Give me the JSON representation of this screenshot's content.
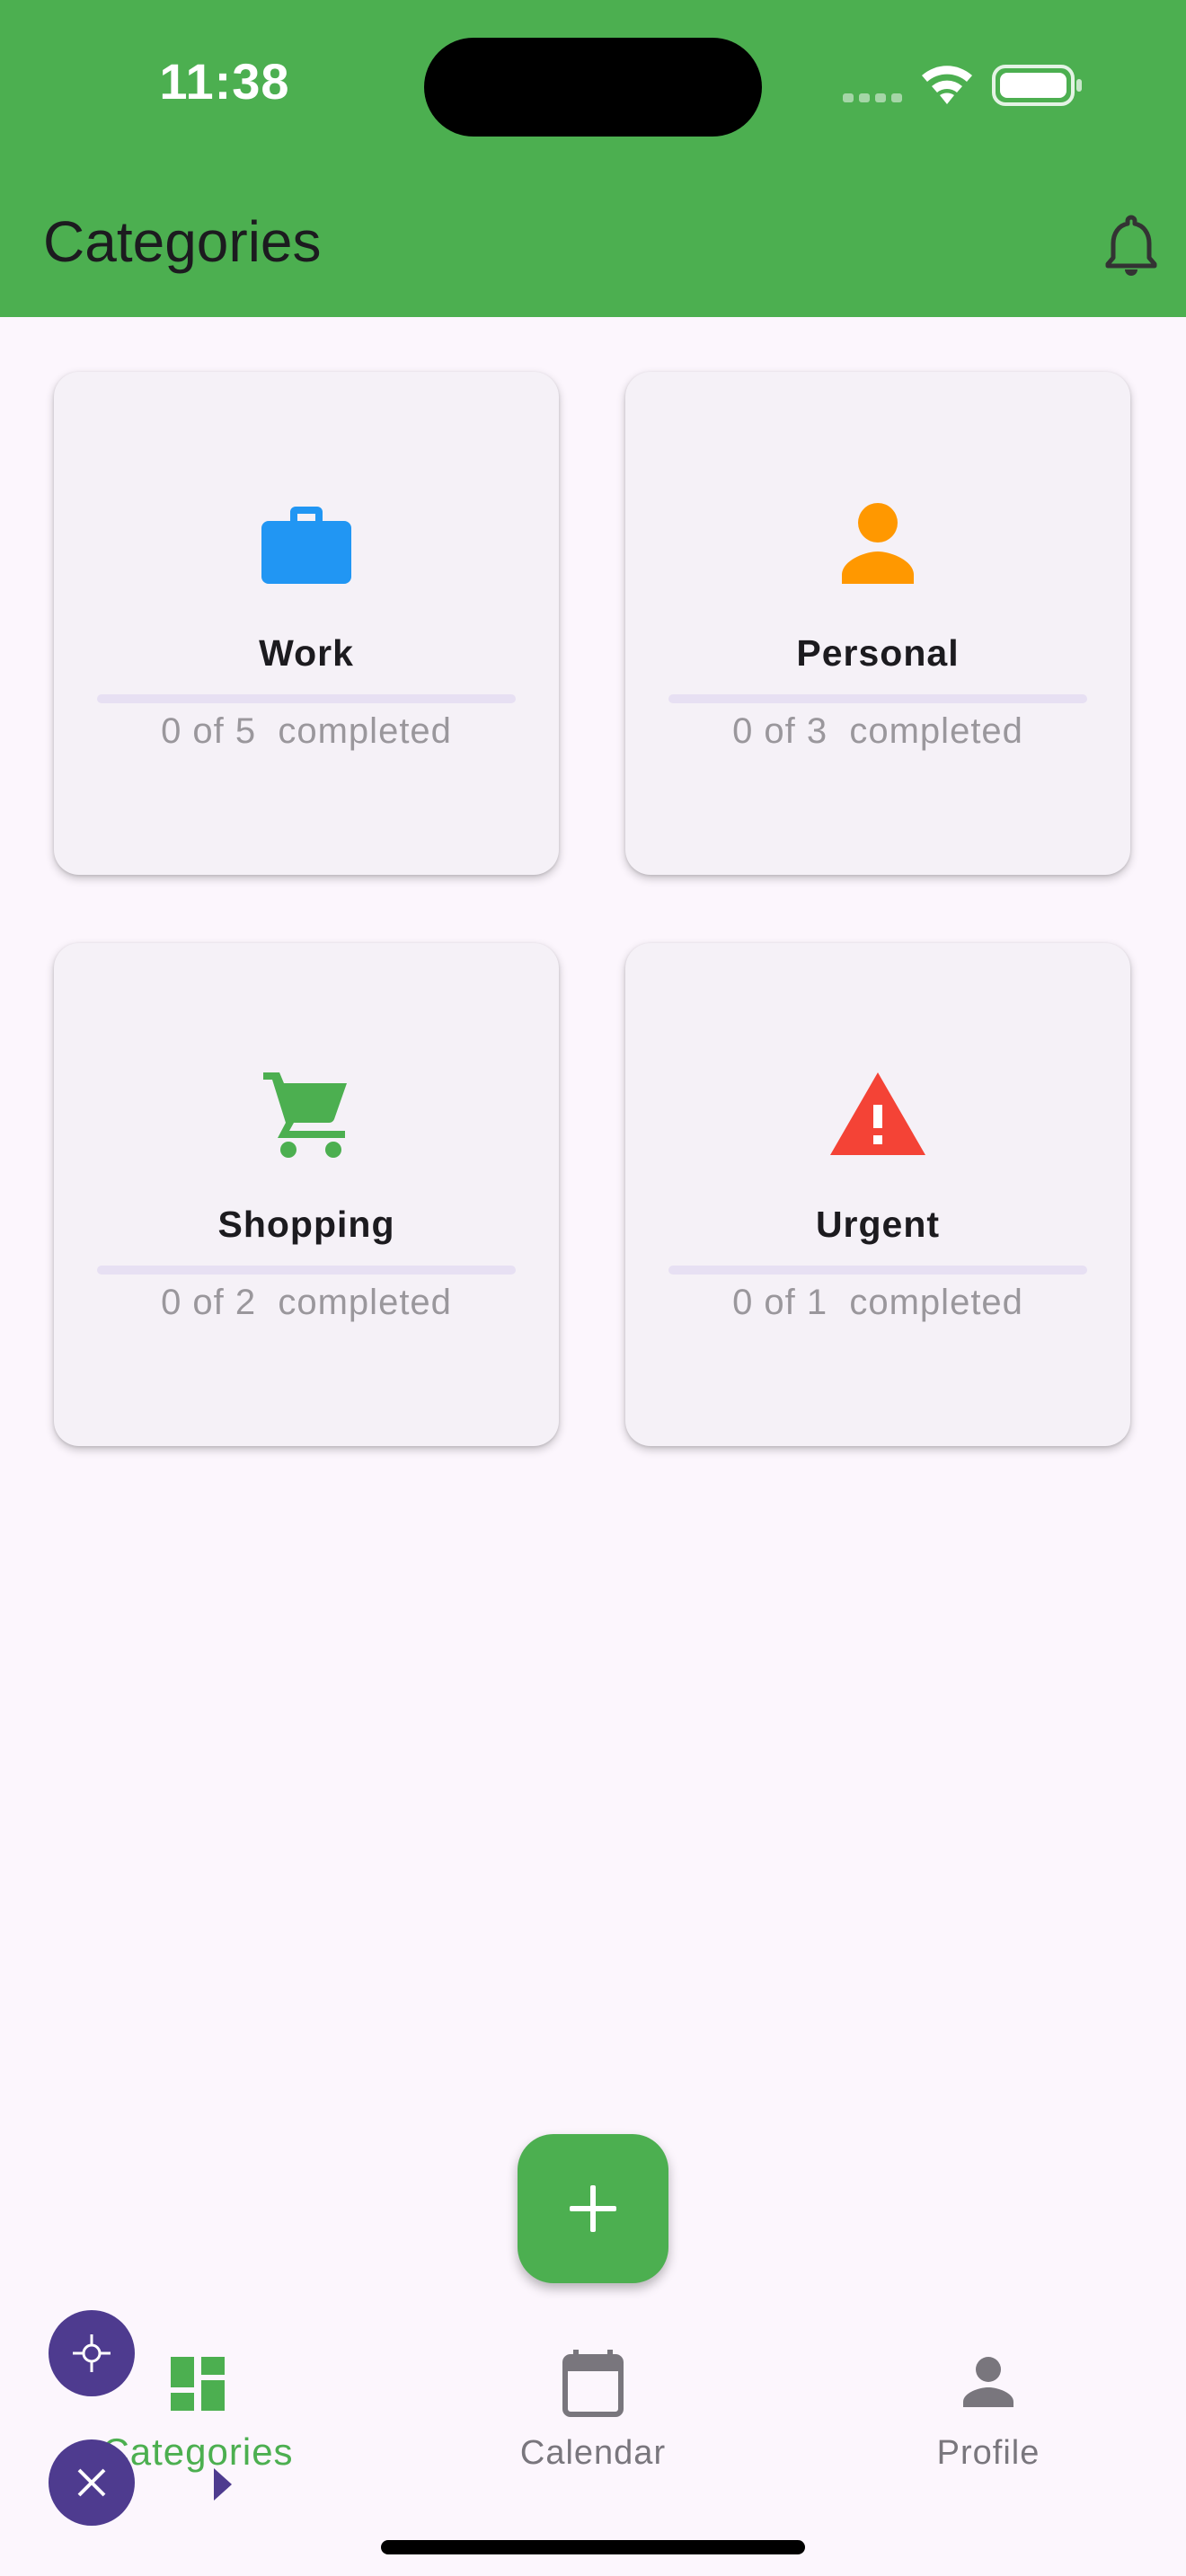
{
  "status_bar": {
    "time": "11:38"
  },
  "app_bar": {
    "title": "Categories",
    "notification_icon": "bell-icon"
  },
  "categories": [
    {
      "name": "Work",
      "icon": "briefcase-icon",
      "color": "#2196f3",
      "completed": 0,
      "total": 5,
      "progress_text": "0 of 5  completed"
    },
    {
      "name": "Personal",
      "icon": "person-icon",
      "color": "#ff9800",
      "completed": 0,
      "total": 3,
      "progress_text": "0 of 3  completed"
    },
    {
      "name": "Shopping",
      "icon": "shopping-cart-icon",
      "color": "#4caf50",
      "completed": 0,
      "total": 2,
      "progress_text": "0 of 2  completed"
    },
    {
      "name": "Urgent",
      "icon": "warning-icon",
      "color": "#f44336",
      "completed": 0,
      "total": 1,
      "progress_text": "0 of 1  completed"
    }
  ],
  "fab": {
    "icon": "plus-icon"
  },
  "bottom_nav": {
    "items": [
      {
        "label": "Categories",
        "icon": "dashboard-icon",
        "active": true
      },
      {
        "label": "Calendar",
        "icon": "calendar-icon",
        "active": false
      },
      {
        "label": "Profile",
        "icon": "person-icon",
        "active": false
      }
    ]
  },
  "colors": {
    "primary": "#4caf50",
    "background": "#fcf6fd",
    "card": "#f5f1f7"
  }
}
